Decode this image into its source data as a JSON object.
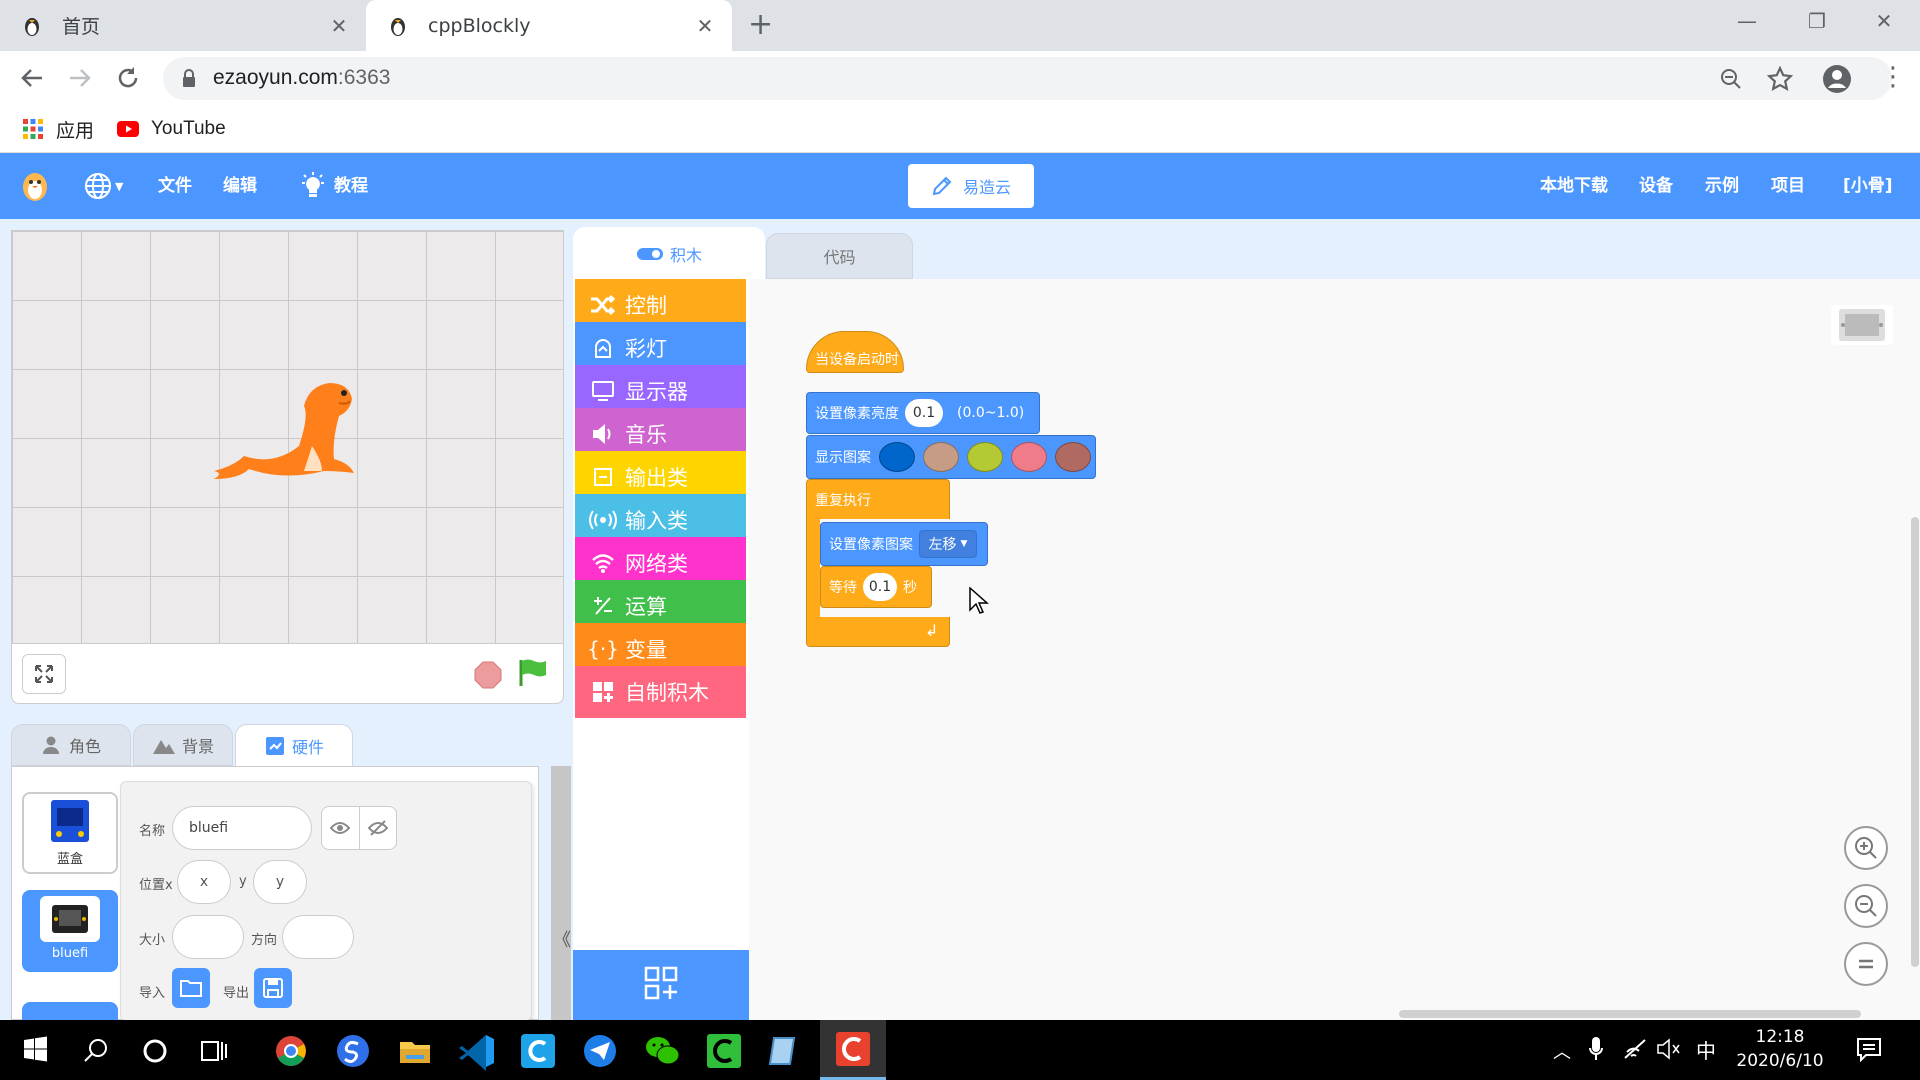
{
  "browser": {
    "tabs": [
      {
        "title": "首页",
        "active": false
      },
      {
        "title": "cppBlockly",
        "active": true
      }
    ],
    "new_tab": "+",
    "url_host": "ezaoyun.com",
    "url_port": ":6363",
    "bookmarks": [
      {
        "label": "应用",
        "icon": "apps-grid-icon"
      },
      {
        "label": "YouTube",
        "icon": "youtube-icon"
      }
    ]
  },
  "app": {
    "menu": {
      "file": "文件",
      "edit": "编辑",
      "tutorial": "教程"
    },
    "cloud_button": "易造云",
    "right_menu": [
      "本地下载",
      "设备",
      "示例",
      "项目",
      "[小骨]"
    ]
  },
  "sprite_tabs": [
    "角色",
    "背景",
    "硬件"
  ],
  "sprites": [
    {
      "label": "蓝盒",
      "selected": false
    },
    {
      "label": "bluefi",
      "selected": true
    }
  ],
  "props": {
    "name_label": "名称",
    "name_value": "bluefi",
    "pos_label": "位置x",
    "x_placeholder": "x",
    "y_label": "y",
    "y_placeholder": "y",
    "size_label": "大小",
    "dir_label": "方向",
    "import_label": "导入",
    "export_label": "导出",
    "collapse": "《"
  },
  "editor_tabs": [
    "积木",
    "代码"
  ],
  "categories": [
    {
      "label": "控制",
      "color": "#ffab19",
      "icon": "shuffle-icon"
    },
    {
      "label": "彩灯",
      "color": "#4c97ff",
      "icon": "light-icon"
    },
    {
      "label": "显示器",
      "color": "#9966ff",
      "icon": "monitor-icon"
    },
    {
      "label": "音乐",
      "color": "#cf63cf",
      "icon": "speaker-icon"
    },
    {
      "label": "输出类",
      "color": "#ffd500",
      "icon": "output-icon"
    },
    {
      "label": "输入类",
      "color": "#4cbfe6",
      "icon": "broadcast-icon"
    },
    {
      "label": "网络类",
      "color": "#ff33cc",
      "icon": "wifi-icon"
    },
    {
      "label": "运算",
      "color": "#40bf4a",
      "icon": "math-icon"
    },
    {
      "label": "变量",
      "color": "#ff8c1a",
      "icon": "braces-icon"
    },
    {
      "label": "自制积木",
      "color": "#ff6680",
      "icon": "blocks-icon"
    }
  ],
  "blocks": {
    "hat": "当设备启动时",
    "brightness_label": "设置像素亮度",
    "brightness_value": "0.1",
    "brightness_range": "(0.0~1.0)",
    "show_pattern": "显示图案",
    "pattern_colors": [
      "#0066cc",
      "#c69c86",
      "#b5c934",
      "#f07c8a",
      "#b06a62"
    ],
    "repeat": "重复执行",
    "set_pattern": "设置像素图案",
    "direction": "左移",
    "wait": "等待",
    "wait_value": "0.1",
    "wait_unit": "秒"
  },
  "taskbar": {
    "time": "12:18",
    "date": "2020/6/10",
    "ime": "中"
  }
}
